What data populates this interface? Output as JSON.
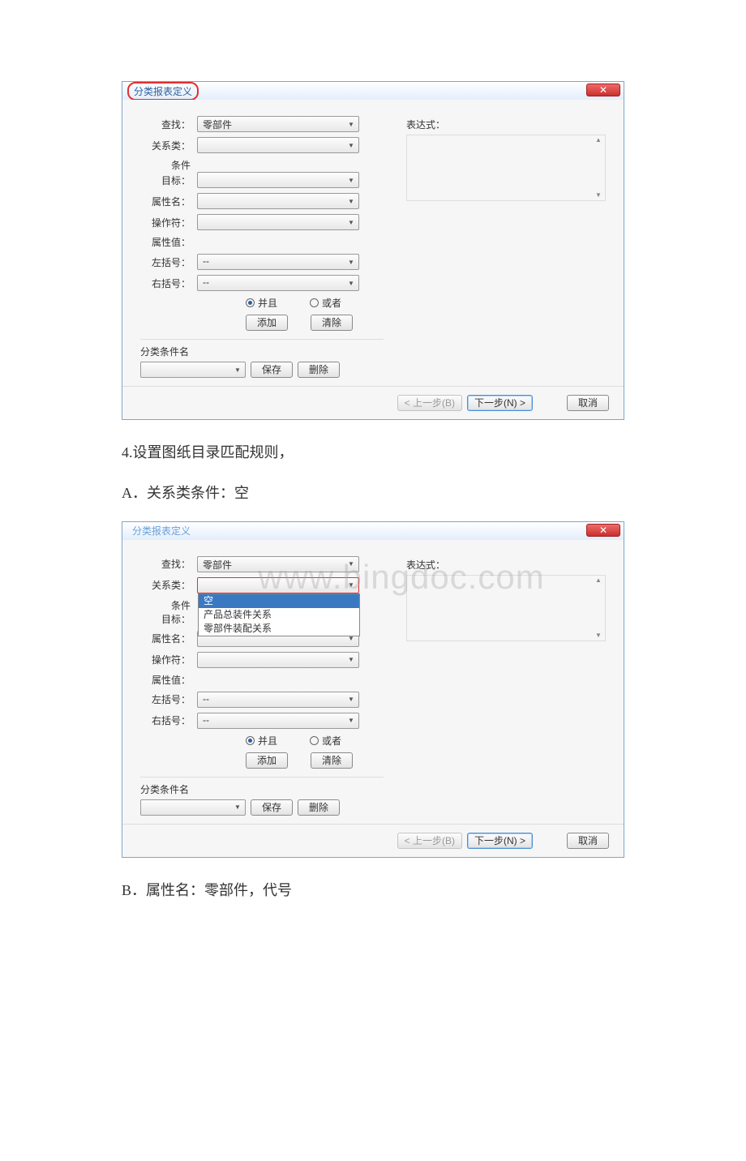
{
  "doc_text": {
    "step4": "4.设置图纸目录匹配规则，",
    "stepA": "A．关系类条件：空",
    "stepB": "B．属性名：零部件，代号"
  },
  "watermark": "www.bingdoc.com",
  "dialog1": {
    "title": "分类报表定义",
    "close": "✕",
    "labels": {
      "search": "查找：",
      "relation": "关系类：",
      "cond": "条件",
      "target": "目标：",
      "attrname": "属性名：",
      "operator": "操作符：",
      "attrval": "属性值：",
      "lbracket": "左括号：",
      "rbracket": "右括号：",
      "expr": "表达式：",
      "condname": "分类条件名"
    },
    "values": {
      "search": "零部件",
      "lbracket": "--",
      "rbracket": "--"
    },
    "radio_and": "并且",
    "radio_or": "或者",
    "btn_add": "添加",
    "btn_clear": "清除",
    "btn_save": "保存",
    "btn_delete": "删除",
    "btn_back": "< 上一步(B)",
    "btn_next": "下一步(N) >",
    "btn_cancel": "取消"
  },
  "dialog2": {
    "title": "分类报表定义",
    "close": "✕",
    "labels": {
      "search": "查找：",
      "relation": "关系类：",
      "cond": "条件",
      "target": "目标：",
      "attrname": "属性名：",
      "operator": "操作符：",
      "attrval": "属性值：",
      "lbracket": "左括号：",
      "rbracket": "右括号：",
      "expr": "表达式：",
      "condname": "分类条件名"
    },
    "values": {
      "search": "零部件",
      "lbracket": "--",
      "rbracket": "--"
    },
    "relation_options": {
      "opt0": "空",
      "opt1": "产品总装件关系",
      "opt2": "零部件装配关系"
    },
    "radio_and": "并且",
    "radio_or": "或者",
    "btn_add": "添加",
    "btn_clear": "清除",
    "btn_save": "保存",
    "btn_delete": "删除",
    "btn_back": "< 上一步(B)",
    "btn_next": "下一步(N) >",
    "btn_cancel": "取消"
  }
}
